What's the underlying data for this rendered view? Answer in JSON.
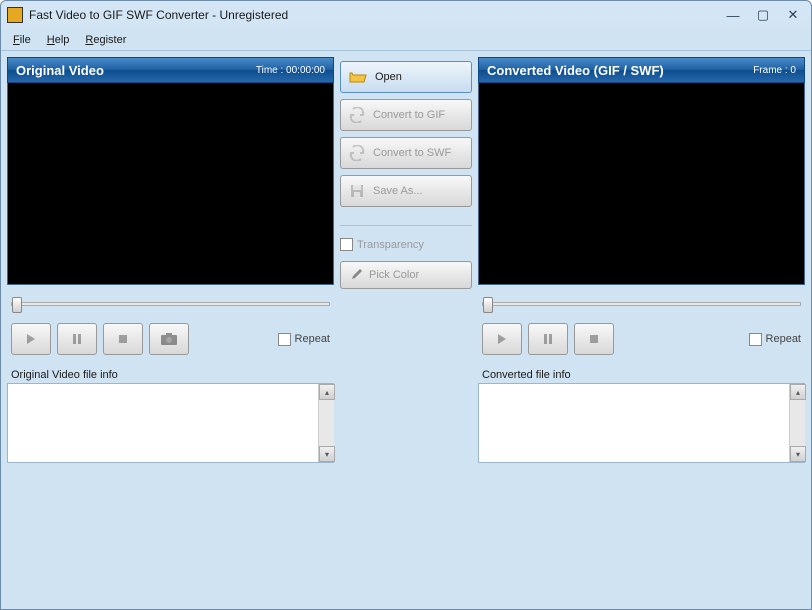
{
  "window": {
    "title": "Fast Video to GIF SWF Converter - Unregistered"
  },
  "menu": {
    "file": "File",
    "help": "Help",
    "register": "Register"
  },
  "leftPanel": {
    "title": "Original Video",
    "timeLabel": "Time : 00:00:00",
    "repeat": "Repeat",
    "infoLabel": "Original Video file info"
  },
  "rightPanel": {
    "title": "Converted Video (GIF / SWF)",
    "frameLabel": "Frame : 0",
    "repeat": "Repeat",
    "infoLabel": "Converted file info"
  },
  "center": {
    "open": "Open",
    "convertGif": "Convert to GIF",
    "convertSwf": "Convert to SWF",
    "saveAs": "Save As...",
    "transparency": "Transparency",
    "pickColor": "Pick Color"
  }
}
